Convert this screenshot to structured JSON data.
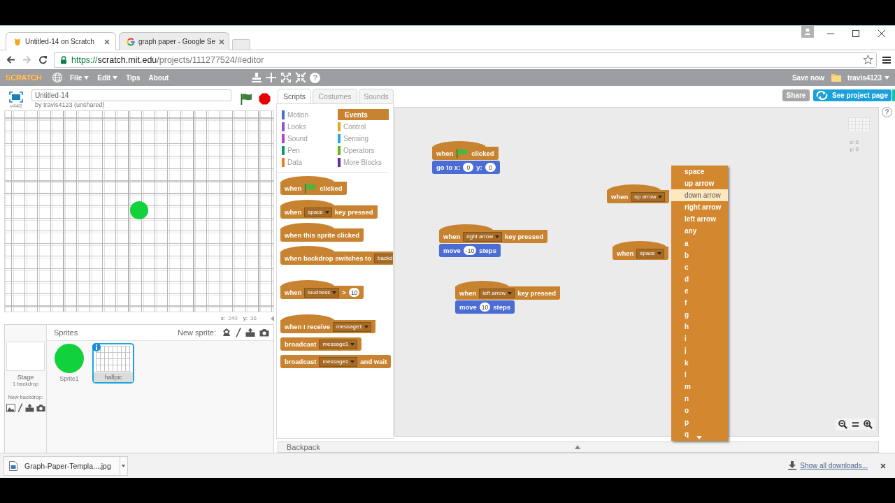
{
  "tabs": [
    {
      "title": "Untitled-14 on Scratch",
      "selected": true
    },
    {
      "title": "graph paper - Google Se",
      "selected": false
    }
  ],
  "toolbar": {
    "nav": [
      {
        "kind": "back",
        "disabled": false
      },
      {
        "kind": "forward",
        "disabled": true
      },
      {
        "kind": "reload",
        "disabled": false
      }
    ],
    "url": {
      "scheme": "https://",
      "host": "scratch.mit.edu",
      "path": "/projects/111277524/#editor"
    }
  },
  "menubar": {
    "logo": "SCRATCH",
    "menus": [
      {
        "label": "File",
        "has_menu": true
      },
      {
        "label": "Edit",
        "has_menu": true
      },
      {
        "label": "Tips",
        "has_menu": false
      },
      {
        "label": "About",
        "has_menu": false
      }
    ],
    "help": "?",
    "save": "Save now",
    "user": "travis4123"
  },
  "stage": {
    "title": "Untitled-14",
    "byline": "by travis4123 (unshared)",
    "version": "v446",
    "mouse": [
      {
        "label": "x:",
        "value": "240"
      },
      {
        "label": "y:",
        "value": "36"
      }
    ]
  },
  "sprite_pane": {
    "stage_label": "Stage",
    "backdrops": "1 backdrop",
    "new_backdrop": "New backdrop:",
    "title": "Sprites",
    "new_sprite": "New sprite:",
    "sprites": [
      {
        "name": "Sprite1",
        "kind": "circle",
        "selected": false
      },
      {
        "name": "halfpic",
        "kind": "grid",
        "selected": true
      }
    ]
  },
  "palette": {
    "tabs": [
      {
        "label": "Scripts",
        "selected": true
      },
      {
        "label": "Costumes",
        "selected": false
      },
      {
        "label": "Sounds",
        "selected": false
      }
    ],
    "categories": [
      {
        "label": "Motion",
        "color": "#4a6cd4",
        "selected": false
      },
      {
        "label": "Looks",
        "color": "#8a55d7",
        "selected": false
      },
      {
        "label": "Sound",
        "color": "#bb42c3",
        "selected": false
      },
      {
        "label": "Pen",
        "color": "#0e9a6c",
        "selected": false
      },
      {
        "label": "Data",
        "color": "#ee7d16",
        "selected": false
      },
      {
        "label": "Events",
        "color": "#c88330",
        "selected": true
      },
      {
        "label": "Control",
        "color": "#e1a91a",
        "selected": false
      },
      {
        "label": "Sensing",
        "color": "#2ca5e2",
        "selected": false
      },
      {
        "label": "Operators",
        "color": "#5cb712",
        "selected": false
      },
      {
        "label": "More Blocks",
        "color": "#632d99",
        "selected": false
      }
    ],
    "blocks": [
      {
        "kind": "hat",
        "color": "#c88330",
        "parts": [
          {
            "kind": "text",
            "text": "when"
          },
          {
            "kind": "flag"
          },
          {
            "kind": "text",
            "text": "clicked"
          }
        ]
      },
      {
        "kind": "hat",
        "color": "#c88330",
        "parts": [
          {
            "kind": "text",
            "text": "when"
          },
          {
            "kind": "dropdown",
            "text": "space"
          },
          {
            "kind": "text",
            "text": "key pressed"
          }
        ]
      },
      {
        "kind": "hat",
        "color": "#c88330",
        "parts": [
          {
            "kind": "text",
            "text": "when this sprite clicked"
          }
        ]
      },
      {
        "kind": "hat",
        "color": "#c88330",
        "parts": [
          {
            "kind": "text",
            "text": "when backdrop switches to"
          },
          {
            "kind": "clipped_dropdown",
            "text": "backd"
          }
        ]
      },
      {
        "kind": "hat",
        "color": "#c88330",
        "parts": [
          {
            "kind": "text",
            "text": "when"
          },
          {
            "kind": "dropdown",
            "text": "loudness"
          },
          {
            "kind": "text",
            "text": ">"
          },
          {
            "kind": "number",
            "text": "10"
          }
        ]
      },
      {
        "kind": "hat",
        "color": "#c88330",
        "parts": [
          {
            "kind": "text",
            "text": "when I receive"
          },
          {
            "kind": "dropdown",
            "text": "message1"
          }
        ]
      },
      {
        "kind": "stack",
        "color": "#c88330",
        "parts": [
          {
            "kind": "text",
            "text": "broadcast"
          },
          {
            "kind": "dropdown",
            "text": "message1"
          }
        ]
      },
      {
        "kind": "stack",
        "color": "#c88330",
        "parts": [
          {
            "kind": "text",
            "text": "broadcast"
          },
          {
            "kind": "dropdown",
            "text": "message1"
          },
          {
            "kind": "text",
            "text": "and wait"
          }
        ]
      }
    ]
  },
  "share": {
    "share": "Share",
    "project_page": "See project page"
  },
  "scripts": [
    {
      "blocks": [
        {
          "kind": "hat",
          "color": "#c88330",
          "parts": [
            {
              "kind": "text",
              "text": "when"
            },
            {
              "kind": "flag"
            },
            {
              "kind": "text",
              "text": "clicked"
            }
          ]
        },
        {
          "kind": "stack",
          "color": "#4a6cd4",
          "parts": [
            {
              "kind": "text",
              "text": "go to x:"
            },
            {
              "kind": "number",
              "text": "0"
            },
            {
              "kind": "text",
              "text": "y:"
            },
            {
              "kind": "number",
              "text": "0"
            }
          ]
        }
      ]
    },
    {
      "blocks": [
        {
          "kind": "hat",
          "color": "#c88330",
          "parts": [
            {
              "kind": "text",
              "text": "when"
            },
            {
              "kind": "dropdown",
              "text": "up arrow"
            }
          ]
        }
      ]
    },
    {
      "blocks": [
        {
          "kind": "hat",
          "color": "#c88330",
          "parts": [
            {
              "kind": "text",
              "text": "when"
            },
            {
              "kind": "dropdown",
              "text": "right arrow"
            },
            {
              "kind": "text",
              "text": "key pressed"
            }
          ]
        },
        {
          "kind": "stack",
          "color": "#4a6cd4",
          "parts": [
            {
              "kind": "text",
              "text": "move"
            },
            {
              "kind": "number",
              "text": "-10"
            },
            {
              "kind": "text",
              "text": "steps"
            }
          ]
        }
      ]
    },
    {
      "blocks": [
        {
          "kind": "hat",
          "color": "#c88330",
          "parts": [
            {
              "kind": "text",
              "text": "when"
            },
            {
              "kind": "dropdown",
              "text": "space"
            }
          ]
        }
      ]
    },
    {
      "blocks": [
        {
          "kind": "hat",
          "color": "#c88330",
          "parts": [
            {
              "kind": "text",
              "text": "when"
            },
            {
              "kind": "dropdown",
              "text": "left arrow"
            },
            {
              "kind": "text",
              "text": "key pressed"
            }
          ]
        },
        {
          "kind": "stack",
          "color": "#4a6cd4",
          "parts": [
            {
              "kind": "text",
              "text": "move"
            },
            {
              "kind": "number",
              "text": "10"
            },
            {
              "kind": "text",
              "text": "steps"
            }
          ]
        }
      ]
    }
  ],
  "key_menu": {
    "items": [
      {
        "label": "space",
        "selected": false
      },
      {
        "label": "up arrow",
        "selected": false
      },
      {
        "label": "down arrow",
        "selected": true
      },
      {
        "label": "right arrow",
        "selected": false
      },
      {
        "label": "left arrow",
        "selected": false
      },
      {
        "label": "any",
        "selected": false
      },
      {
        "label": "a",
        "selected": false
      },
      {
        "label": "b",
        "selected": false
      },
      {
        "label": "c",
        "selected": false
      },
      {
        "label": "d",
        "selected": false
      },
      {
        "label": "e",
        "selected": false
      },
      {
        "label": "f",
        "selected": false
      },
      {
        "label": "g",
        "selected": false
      },
      {
        "label": "h",
        "selected": false
      },
      {
        "label": "i",
        "selected": false
      },
      {
        "label": "j",
        "selected": false
      },
      {
        "label": "k",
        "selected": false
      },
      {
        "label": "l",
        "selected": false
      },
      {
        "label": "m",
        "selected": false
      },
      {
        "label": "n",
        "selected": false
      },
      {
        "label": "o",
        "selected": false
      },
      {
        "label": "p",
        "selected": false
      },
      {
        "label": "q",
        "selected": false
      }
    ]
  },
  "sprite_position": [
    {
      "label": "x:",
      "value": "0"
    },
    {
      "label": "y:",
      "value": "0"
    }
  ],
  "backpack": "Backpack",
  "help_tab": "?",
  "downloads": {
    "file": "Graph-Paper-Templa....jpg",
    "show_all": "Show all downloads..."
  }
}
